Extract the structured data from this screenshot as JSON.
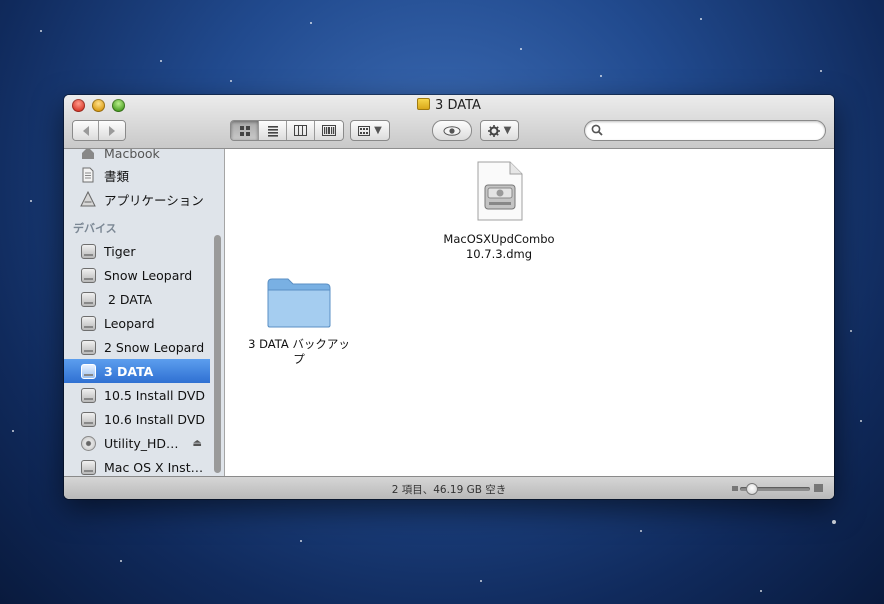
{
  "window": {
    "title": "3 DATA"
  },
  "sidebar": {
    "partial_item_label": "Macbook",
    "places": [
      {
        "label": "書類",
        "icon": "document-icon"
      },
      {
        "label": "アプリケーション",
        "icon": "applications-icon"
      }
    ],
    "devices_header": "デバイス",
    "devices": [
      {
        "label": "Tiger",
        "icon": "disk-icon"
      },
      {
        "label": "Snow Leopard",
        "icon": "disk-icon"
      },
      {
        "label": " 2 DATA",
        "icon": "disk-icon"
      },
      {
        "label": "Leopard",
        "icon": "disk-icon"
      },
      {
        "label": "2 Snow Leopard",
        "icon": "disk-icon"
      },
      {
        "label": "3 DATA",
        "icon": "disk-icon",
        "selected": true
      },
      {
        "label": "10.5 Install DVD",
        "icon": "disk-icon"
      },
      {
        "label": "10.6 Install DVD",
        "icon": "disk-icon"
      },
      {
        "label": "Utility_HD…",
        "icon": "optical-disc-icon",
        "eject": true
      },
      {
        "label": "Mac OS X Inst…",
        "icon": "disk-icon"
      }
    ]
  },
  "files": [
    {
      "label_line1": "MacOSXUpdCombo",
      "label_line2": "10.7.3.dmg",
      "icon": "dmg-file-icon"
    },
    {
      "label_line1": "3 DATA バックアッ",
      "label_line2": "プ",
      "icon": "folder-icon"
    }
  ],
  "status": {
    "text": "2 項目、46.19 GB 空き"
  },
  "colors": {
    "selection": "#3a7fdc",
    "sidebar_bg": "#dfe4ea",
    "desktop": "#214a8e"
  }
}
